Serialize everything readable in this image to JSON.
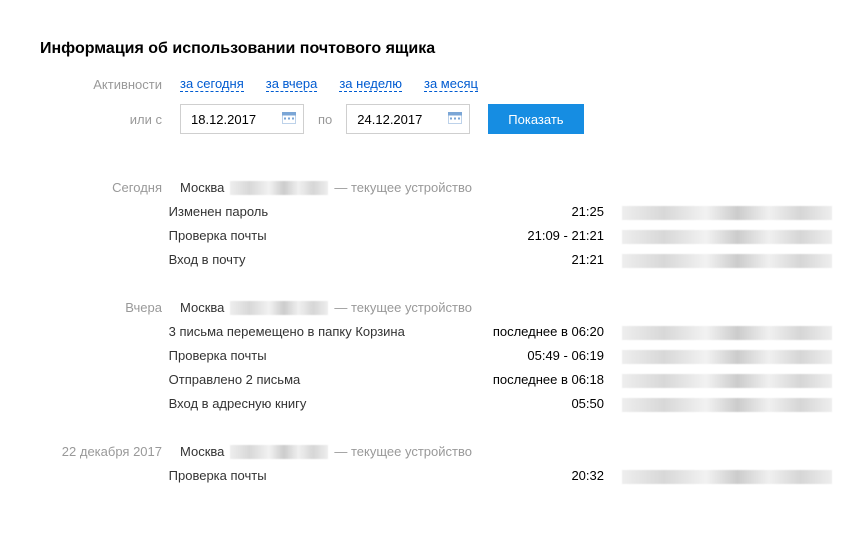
{
  "title": "Информация об использовании почтового ящика",
  "filters": {
    "activity_label": "Активности",
    "today": "за сегодня",
    "yesterday": "за вчера",
    "week": "за неделю",
    "month": "за месяц"
  },
  "range": {
    "or_from": "или с",
    "from_value": "18.12.2017",
    "to_label": "по",
    "to_value": "24.12.2017",
    "show_button": "Показать"
  },
  "sections": [
    {
      "day": "Сегодня",
      "location_city": "Москва",
      "location_suffix": "— текущее устройство",
      "events": [
        {
          "text": "Изменен пароль",
          "time": "21:25"
        },
        {
          "text": "Проверка почты",
          "time": "21:09 - 21:21"
        },
        {
          "text": "Вход в почту",
          "time": "21:21"
        }
      ]
    },
    {
      "day": "Вчера",
      "location_city": "Москва",
      "location_suffix": "— текущее устройство",
      "events": [
        {
          "text": "3 письма перемещено в папку Корзина",
          "time": "последнее в 06:20"
        },
        {
          "text": "Проверка почты",
          "time": "05:49 - 06:19"
        },
        {
          "text": "Отправлено 2 письма",
          "time": "последнее в 06:18"
        },
        {
          "text": "Вход в адресную книгу",
          "time": "05:50"
        }
      ]
    },
    {
      "day": "22 декабря 2017",
      "location_city": "Москва",
      "location_suffix": "— текущее устройство",
      "events": [
        {
          "text": "Проверка почты",
          "time": "20:32"
        }
      ]
    }
  ]
}
